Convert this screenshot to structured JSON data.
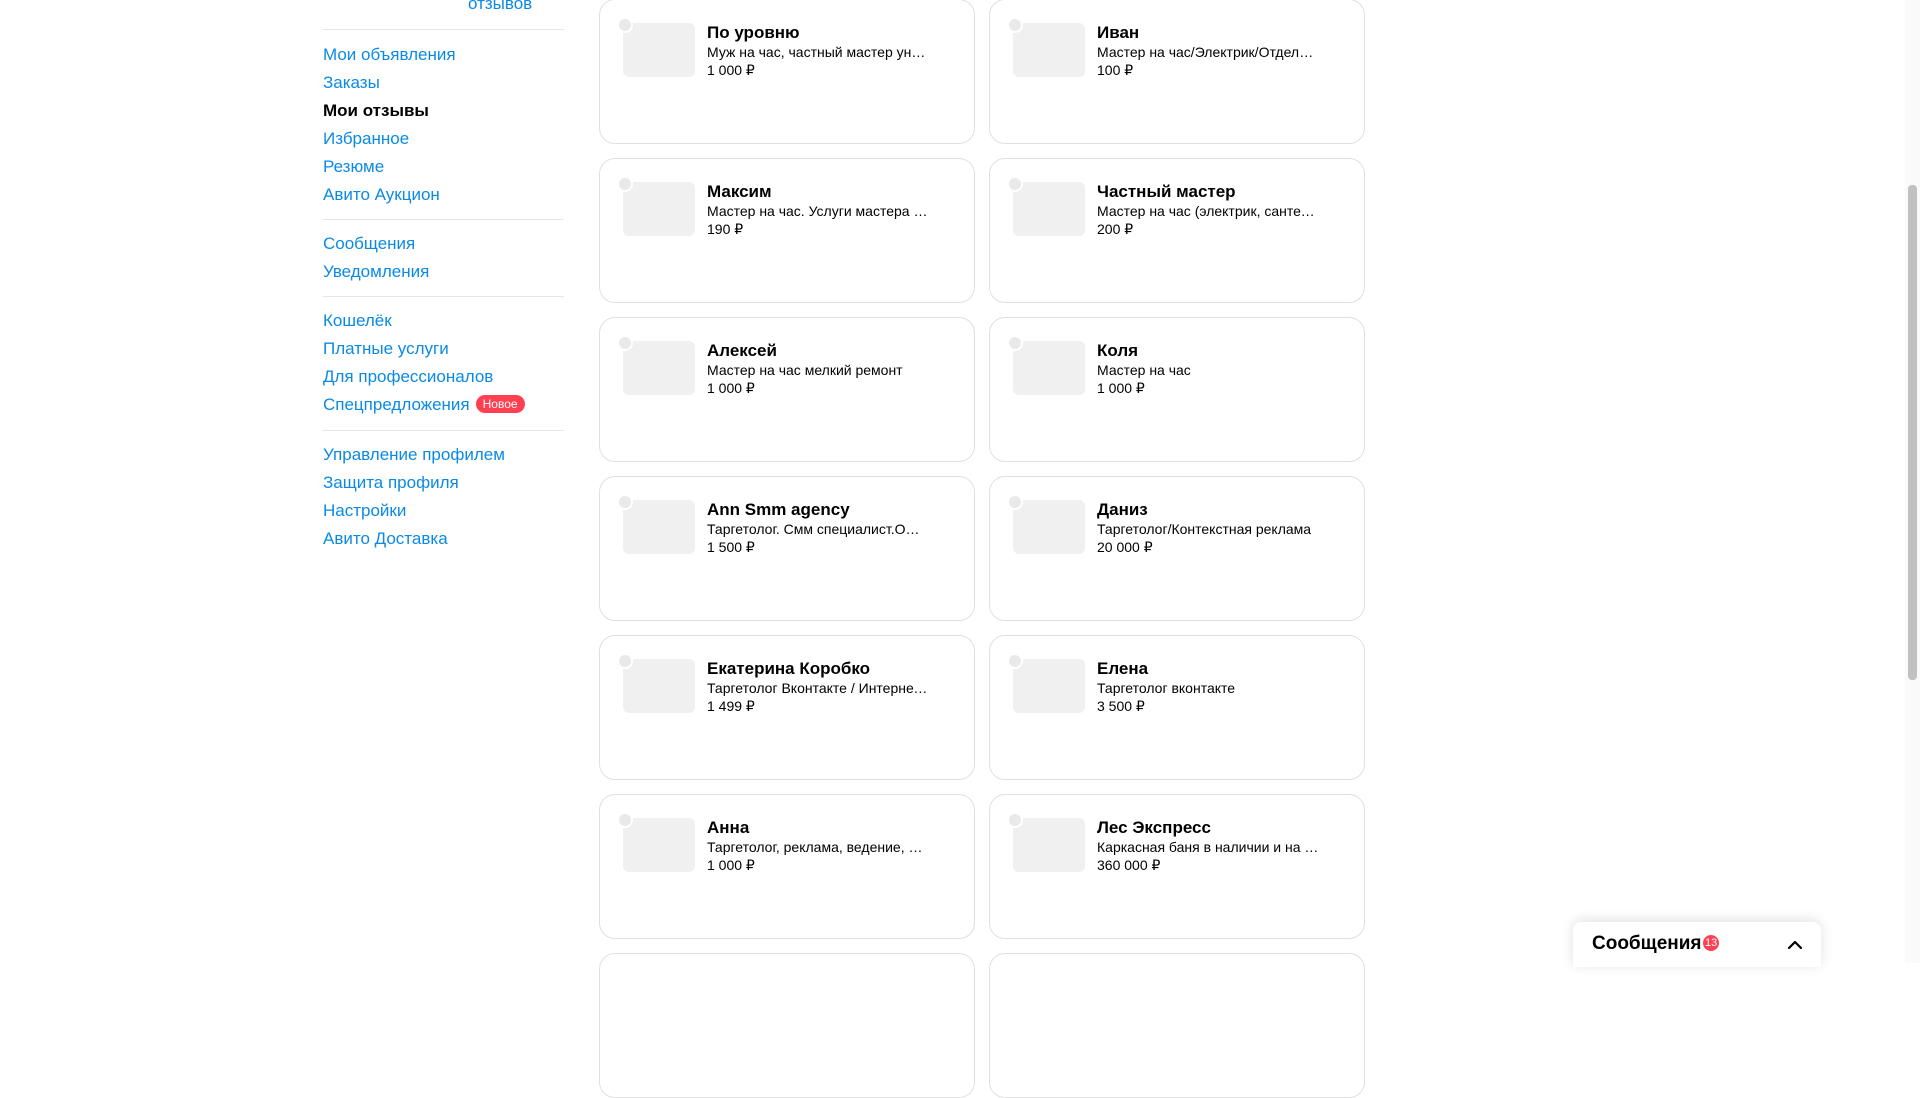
{
  "sidebar": {
    "top_link": "отзывов",
    "groups": [
      [
        {
          "label": "Мои объявления"
        },
        {
          "label": "Заказы"
        },
        {
          "label": "Мои отзывы"
        },
        {
          "label": "Избранное"
        },
        {
          "label": "Резюме"
        },
        {
          "label": "Авито Аукцион"
        }
      ],
      [
        {
          "label": "Сообщения"
        },
        {
          "label": "Уведомления"
        }
      ],
      [
        {
          "label": "Кошелёк"
        },
        {
          "label": "Платные услуги"
        },
        {
          "label": "Для профессионалов"
        },
        {
          "label": "Спецпредложения",
          "badge": "Новое"
        }
      ],
      [
        {
          "label": "Управление профилем"
        },
        {
          "label": "Защита профиля"
        },
        {
          "label": "Настройки"
        },
        {
          "label": "Авито Доставка"
        }
      ]
    ]
  },
  "cards": [
    {
      "title": "По уровню",
      "desc": "Муж на час, частный мастер универсал",
      "price": "1 000 ₽"
    },
    {
      "title": "Иван",
      "desc": "Мастер на час/Электрик/Отделочник",
      "price": "100 ₽"
    },
    {
      "title": "Максим",
      "desc": "Мастер на час. Услуги мастера на час",
      "price": "190 ₽"
    },
    {
      "title": "Частный мастер",
      "desc": "Мастер на час (электрик, сантехник)",
      "price": "200 ₽"
    },
    {
      "title": "Алексей",
      "desc": "Мастер на час мелкий ремонт",
      "price": "1 000 ₽"
    },
    {
      "title": "Коля",
      "desc": "Мастер на час",
      "price": "1 000 ₽"
    },
    {
      "title": "Ann Smm agency",
      "desc": "Таргетолог. Смм специалист.Оформление",
      "price": "1 500 ₽"
    },
    {
      "title": "Даниз",
      "desc": "Таргетолог/Контекстная реклама",
      "price": "20 000 ₽"
    },
    {
      "title": "Екатерина Коробко",
      "desc": "Таргетолог Вконтакте / Интернет маркетолог",
      "price": "1 499 ₽"
    },
    {
      "title": "Елена",
      "desc": "Таргетолог вконтакте",
      "price": "3 500 ₽"
    },
    {
      "title": "Анна",
      "desc": "Таргетолог, реклама, ведение, продвижение",
      "price": "1 000 ₽"
    },
    {
      "title": "Лес Экспресс",
      "desc": "Каркасная баня в наличии и на заказ",
      "price": "360 000 ₽"
    }
  ],
  "messages_widget": {
    "label": "Сообщения",
    "count": "13"
  }
}
